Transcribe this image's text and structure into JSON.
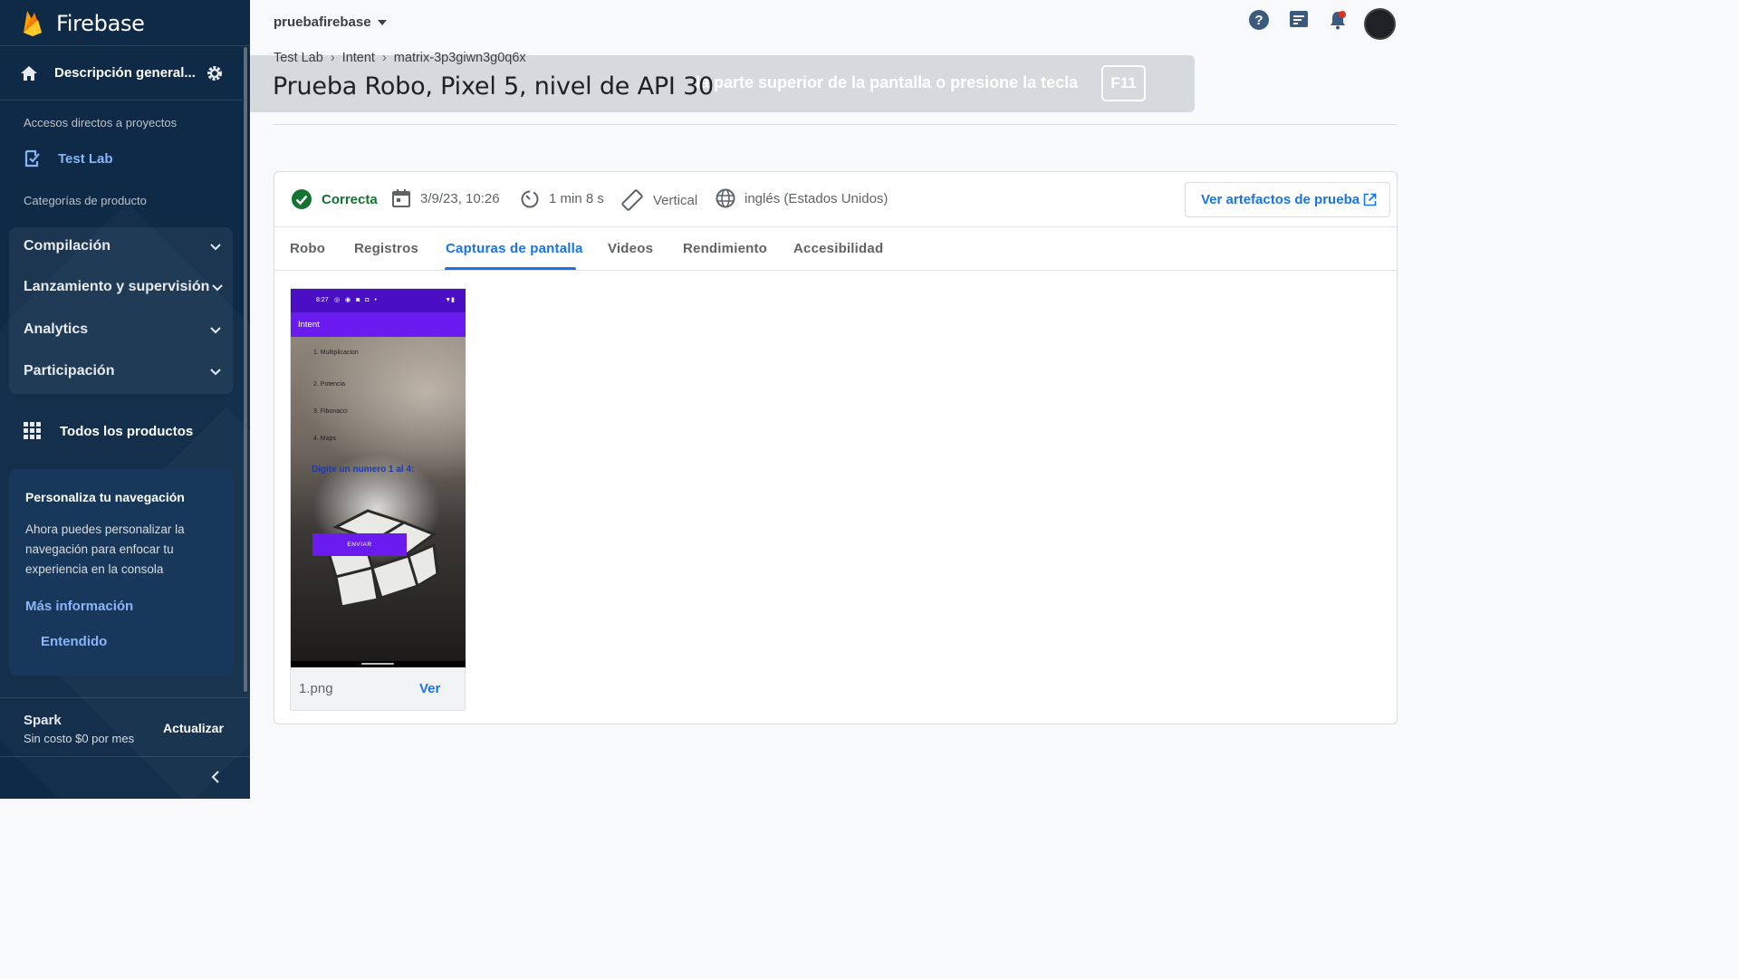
{
  "sidebar": {
    "brand": "Firebase",
    "overview": "Descripción general...",
    "shortcuts_label": "Accesos directos a proyectos",
    "shortcut": "Test Lab",
    "categories_label": "Categorías de producto",
    "categories": [
      "Compilación",
      "Lanzamiento y supervisión",
      "Analytics",
      "Participación"
    ],
    "all_products": "Todos los productos",
    "card": {
      "title": "Personaliza tu navegación",
      "body": "Ahora puedes personalizar la navegación para enfocar tu experiencia en la consola",
      "more": "Más información",
      "dismiss": "Entendido"
    },
    "plan": {
      "name": "Spark",
      "price": "Sin costo $0 por mes",
      "upgrade": "Actualizar"
    }
  },
  "topbar": {
    "project": "pruebafirebase",
    "icons": [
      "help-icon",
      "feedback-icon",
      "notifications-icon",
      "avatar"
    ]
  },
  "breadcrumb": [
    "Test Lab",
    "Intent",
    "matrix-3p3giwn3g0q6x"
  ],
  "title": "Prueba Robo, Pixel 5, nivel de API 30",
  "fullscreen_hint": {
    "message": "la parte superior de la pantalla o presione la tecla",
    "key": "F11"
  },
  "result": {
    "status": "Correcta",
    "date": "3/9/23, 10:26",
    "duration": "1 min 8 s",
    "orientation": "Vertical",
    "locale": "inglés (Estados Unidos)",
    "artifacts_button": "Ver artefactos de prueba",
    "status_color": "#137333",
    "accent_color": "#1a73e8"
  },
  "tabs": [
    "Robo",
    "Registros",
    "Capturas de pantalla",
    "Videos",
    "Rendimiento",
    "Accesibilidad"
  ],
  "active_tab": "Capturas de pantalla",
  "screenshot": {
    "filename": "1.png",
    "view_label": "Ver",
    "phone": {
      "time": "8:27",
      "app_title": "Intent",
      "items": [
        "1. Multiplicacion",
        "2. Potencia",
        "3. Fibonacci",
        "4. Maps"
      ],
      "prompt": "Digite un numero 1 al 4:",
      "button": "ENVIAR"
    }
  }
}
